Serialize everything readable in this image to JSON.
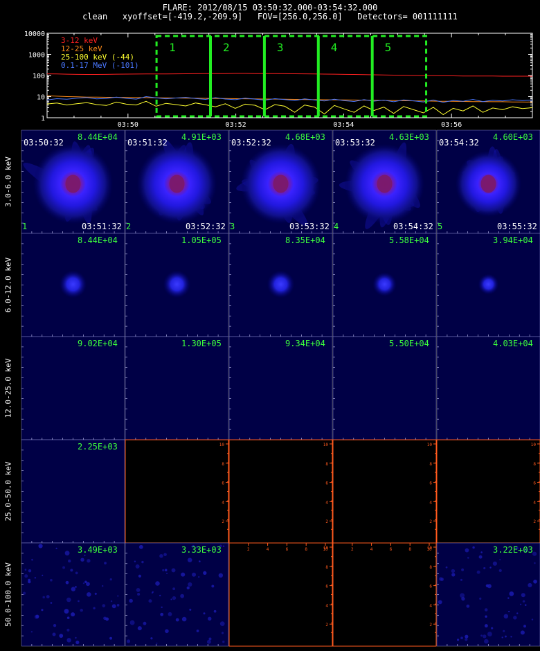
{
  "header": {
    "line1": "FLARE: 2012/08/15 03:50:32.000-03:54:32.000",
    "line2": "clean   xyoffset=[-419.2,-209.9]   FOV=[256.0,256.0]   Detectors= 001111111"
  },
  "chart_data": {
    "type": "line",
    "yscale": "log",
    "ylim": [
      1,
      10000
    ],
    "yticks": [
      "10000",
      "1000",
      "100",
      "10",
      "1"
    ],
    "xticks": [
      "03:50",
      "03:52",
      "03:54",
      "03:56"
    ],
    "series": [
      {
        "name": "3-12 keV",
        "color": "#ff2020",
        "values": [
          120,
          118,
          115,
          113,
          112,
          112,
          113,
          115,
          116,
          117,
          118,
          118,
          119,
          120,
          121,
          122,
          123,
          124,
          124,
          125,
          125,
          124,
          124,
          123,
          122,
          121,
          120,
          118,
          116,
          115,
          113,
          112,
          110,
          108,
          106,
          104,
          102,
          100,
          99,
          98,
          97,
          96,
          95,
          95,
          94,
          94,
          93,
          93,
          93,
          92
        ]
      },
      {
        "name": "12-25 keV",
        "color": "#ff8c1a",
        "values": [
          11,
          10.5,
          10,
          9.8,
          9.5,
          9.4,
          9.3,
          9.2,
          9.1,
          9,
          8.9,
          8.8,
          8.7,
          8.6,
          8.5,
          8.4,
          8.3,
          8.2,
          8.1,
          8,
          7.9,
          7.8,
          7.7,
          7.6,
          7.5,
          7.4,
          7.3,
          7.2,
          7.1,
          7,
          7,
          6.9,
          6.8,
          6.7,
          6.6,
          6.5,
          6.4,
          6.3,
          6.2,
          6.1,
          6,
          6,
          5.9,
          5.8,
          5.8,
          5.7,
          5.7,
          5.6,
          5.6,
          5.5
        ]
      },
      {
        "name": "25-100 keV (-44)",
        "color": "#ffff30",
        "values": [
          4.5,
          5,
          4,
          4.6,
          5.2,
          4.2,
          3.8,
          5.5,
          4.4,
          4,
          6,
          3.5,
          4.8,
          4.2,
          3.6,
          5,
          4.1,
          3.3,
          4.6,
          2.8,
          4.4,
          3.9,
          2.4,
          4.2,
          3.5,
          1.8,
          4,
          3.2,
          1.5,
          3.8,
          2.6,
          1.8,
          3.6,
          2.2,
          3.2,
          1.6,
          3.4,
          2.4,
          1.7,
          3.1,
          1.4,
          2.8,
          2.1,
          3.6,
          1.8,
          2.9,
          2.4,
          3.3,
          2.7,
          3
        ]
      },
      {
        "name": "0.1-17 MeV (-101)",
        "color": "#4a78ff",
        "values": [
          7,
          8,
          7.5,
          8.5,
          9,
          7.8,
          8.2,
          9.5,
          8.3,
          7.6,
          10,
          8.8,
          7.9,
          8.6,
          9.2,
          8.1,
          7.4,
          8.9,
          7.7,
          7.2,
          8.4,
          7.6,
          6.8,
          8,
          7.3,
          6.5,
          7.8,
          6.9,
          6.2,
          7.5,
          6.4,
          5.9,
          7.2,
          6.1,
          6.8,
          5.7,
          7,
          6.3,
          5.6,
          6.9,
          5.4,
          6.6,
          6,
          7.4,
          5.8,
          6.7,
          6.2,
          7.1,
          6.5,
          6.8
        ]
      }
    ],
    "intervals": [
      "1",
      "2",
      "3",
      "4",
      "5"
    ]
  },
  "rows": [
    {
      "label": "3.0-6.0 keV",
      "cells": [
        {
          "max": "8.44E+04",
          "t0": "03:50:32",
          "t1": "03:51:32",
          "idx": "1",
          "blob": 4,
          "core": true
        },
        {
          "max": "4.91E+03",
          "t0": "03:51:32",
          "t1": "03:52:32",
          "idx": "2",
          "blob": 4,
          "core": true
        },
        {
          "max": "4.68E+03",
          "t0": "03:52:32",
          "t1": "03:53:32",
          "idx": "3",
          "blob": 4,
          "core": true
        },
        {
          "max": "4.63E+03",
          "t0": "03:53:32",
          "t1": "03:54:32",
          "idx": "4",
          "blob": 4,
          "core": true
        },
        {
          "max": "4.60E+03",
          "t0": "03:54:32",
          "t1": "03:55:32",
          "idx": "5",
          "blob": 3,
          "core": true
        }
      ]
    },
    {
      "label": "6.0-12.0 keV",
      "cells": [
        {
          "max": "8.44E+04",
          "blob": 2
        },
        {
          "max": "1.05E+05",
          "blob": 2
        },
        {
          "max": "8.35E+04",
          "blob": 2
        },
        {
          "max": "5.58E+04",
          "blob": 1.5
        },
        {
          "max": "3.94E+04",
          "blob": 1
        }
      ]
    },
    {
      "label": "12.0-25.0 keV",
      "cells": [
        {
          "max": "9.02E+04"
        },
        {
          "max": "1.30E+05"
        },
        {
          "max": "9.34E+04"
        },
        {
          "max": "5.50E+04"
        },
        {
          "max": "4.03E+04"
        }
      ]
    },
    {
      "label": "25.0-50.0 keV",
      "cells": [
        {
          "max": "2.25E+03"
        },
        {
          "empty": true
        },
        {
          "empty": true
        },
        {
          "empty": true
        },
        {
          "empty": true
        }
      ]
    },
    {
      "label": "50.0-100.0 keV",
      "cells": [
        {
          "max": "3.49E+03",
          "noise": true
        },
        {
          "max": "3.33E+03",
          "noise": true
        },
        {
          "empty": true
        },
        {
          "empty": true
        },
        {
          "max": "3.22E+03",
          "noise": true
        }
      ]
    }
  ],
  "empty_axis_ticks": [
    "2",
    "4",
    "6",
    "8",
    "10"
  ]
}
